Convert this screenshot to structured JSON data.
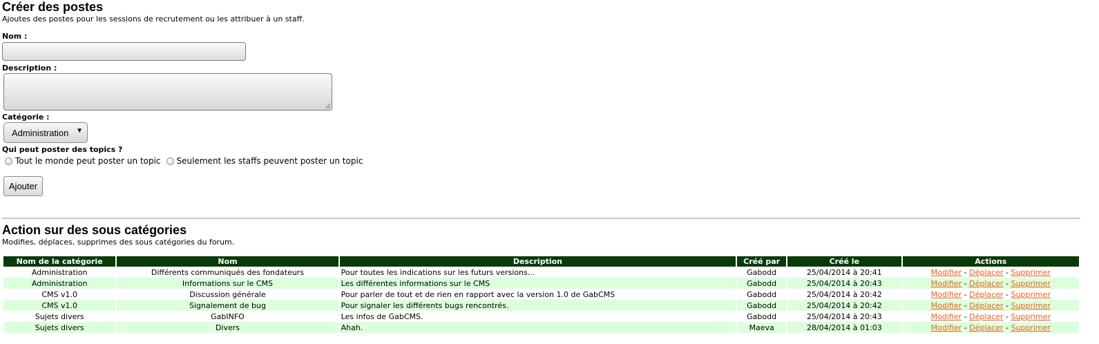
{
  "create": {
    "title": "Créer des postes",
    "description": "Ajoutes des postes pour les sessions de recrutement ou les attribuer à un staff.",
    "name_label": "Nom :",
    "name_value": "",
    "description_label": "Description :",
    "description_value": "",
    "category_label": "Catégorie :",
    "category_selected": "Administration",
    "who_label": "Qui peut poster des topics ?",
    "radio_everyone": "Tout le monde peut poster un topic",
    "radio_staff": "Seulement les staffs peuvent poster un topic",
    "submit_label": "Ajouter"
  },
  "subcats": {
    "title": "Action sur des sous catégories",
    "description": "Modifies, déplaces, supprimes des sous catégories du forum.",
    "columns": [
      "Nom de la catégorie",
      "Nom",
      "Description",
      "Créé par",
      "Créé le",
      "Actions"
    ],
    "action_labels": {
      "edit": "Modifier",
      "move": "Déplacer",
      "delete": "Supprimer",
      "sep": "-"
    },
    "rows": [
      {
        "category": "Administration",
        "name": "Différents communiqués des fondateurs",
        "description": "Pour toutes les indications sur les futurs versions...",
        "author": "Gabodd",
        "date": "25/04/2014 à 20:41"
      },
      {
        "category": "Administration",
        "name": "Informations sur le CMS",
        "description": "Les différentes informations sur le CMS",
        "author": "Gabodd",
        "date": "25/04/2014 à 20:43"
      },
      {
        "category": "CMS v1.0",
        "name": "Discussion générale",
        "description": "Pour parler de tout et de rien en rapport avec la version 1.0 de GabCMS",
        "author": "Gabodd",
        "date": "25/04/2014 à 20:42"
      },
      {
        "category": "CMS v1.0",
        "name": "Signalement de bug",
        "description": "Pour signaler les différents bugs rencontrés.",
        "author": "Gabodd",
        "date": "25/04/2014 à 20:42"
      },
      {
        "category": "Sujets divers",
        "name": "GabINFO",
        "description": "Les infos de GabCMS.",
        "author": "Gabodd",
        "date": "25/04/2014 à 20:43"
      },
      {
        "category": "Sujets divers",
        "name": "Divers",
        "description": "Ahah.",
        "author": "Maeva",
        "date": "28/04/2014 à 01:03"
      }
    ]
  },
  "colors": {
    "header_bg": "#0a3a0a",
    "alt_row_bg": "#dcffdc",
    "link": "#e8601c"
  }
}
